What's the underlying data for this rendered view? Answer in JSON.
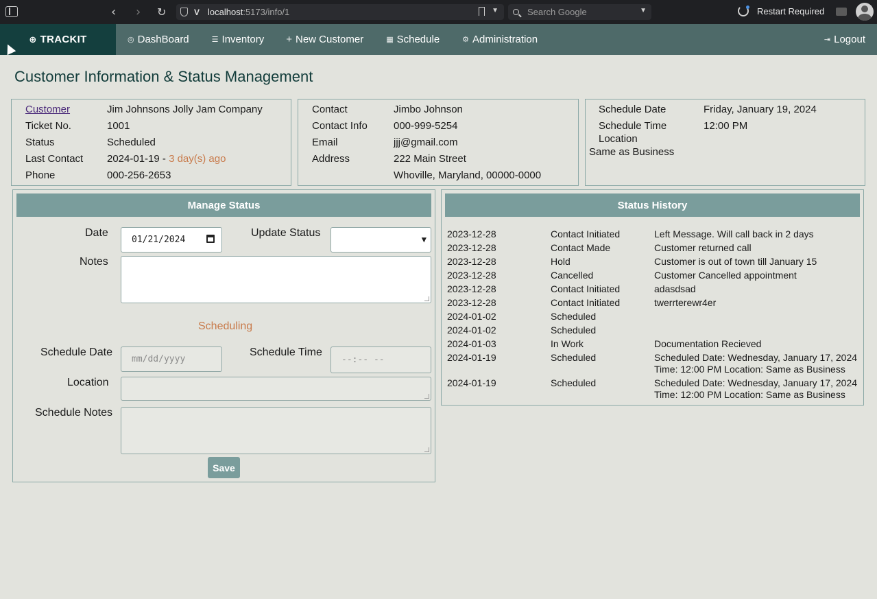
{
  "browser": {
    "url_host": "localhost",
    "url_path": ":5173/info/1",
    "search_placeholder": "Search Google",
    "restart_label": "Restart Required"
  },
  "nav": {
    "brand": "TRACKIT",
    "items": [
      {
        "label": "DashBoard",
        "icon": "dashboard-icon"
      },
      {
        "label": "Inventory",
        "icon": "list-icon"
      },
      {
        "label": "New Customer",
        "icon": "plus-icon"
      },
      {
        "label": "Schedule",
        "icon": "calendar-icon"
      },
      {
        "label": "Administration",
        "icon": "gear-icon"
      }
    ],
    "logout": "Logout"
  },
  "page_title": "Customer Information & Status Management",
  "customer": {
    "customer_label": "Customer",
    "customer_value": "Jim Johnsons Jolly Jam Company",
    "ticket_label": "Ticket No.",
    "ticket_value": "1001",
    "status_label": "Status",
    "status_value": "Scheduled",
    "last_contact_label": "Last Contact",
    "last_contact_value": "2024-01-19 -",
    "last_contact_ago": "3 day(s) ago",
    "phone_label": "Phone",
    "phone_value": "000-256-2653"
  },
  "contact": {
    "contact_label": "Contact",
    "contact_value": "Jimbo Johnson",
    "info_label": "Contact Info",
    "info_value": "000-999-5254",
    "email_label": "Email",
    "email_value": "jjj@gmail.com",
    "address_label": "Address",
    "address_line1": "222 Main Street",
    "address_line2": "Whoville, Maryland, 00000-0000"
  },
  "schedule": {
    "date_label": "Schedule Date",
    "date_value": "Friday, January 19, 2024",
    "time_label": "Schedule Time",
    "time_value": "12:00 PM",
    "location_label": "Location",
    "location_value": "Same as Business"
  },
  "manage": {
    "title": "Manage Status",
    "date_label": "Date",
    "date_value": "01/21/2024",
    "update_status_label": "Update Status",
    "update_status_value": "",
    "notes_label": "Notes",
    "scheduling_heading": "Scheduling",
    "schedule_date_label": "Schedule Date",
    "schedule_date_placeholder": "mm/dd/yyyy",
    "schedule_time_label": "Schedule Time",
    "schedule_time_placeholder": "--:-- --",
    "location_label": "Location",
    "schedule_notes_label": "Schedule Notes",
    "save_label": "Save"
  },
  "history": {
    "title": "Status History",
    "rows": [
      {
        "date": "2023-12-28",
        "status": "Contact Initiated",
        "note": "Left Message. Will call back in 2 days"
      },
      {
        "date": "2023-12-28",
        "status": "Contact Made",
        "note": "Customer returned call"
      },
      {
        "date": "2023-12-28",
        "status": "Hold",
        "note": "Customer is out of town till January 15"
      },
      {
        "date": "2023-12-28",
        "status": "Cancelled",
        "note": "Customer Cancelled appointment"
      },
      {
        "date": "2023-12-28",
        "status": "Contact Initiated",
        "note": "adasdsad"
      },
      {
        "date": "2023-12-28",
        "status": "Contact Initiated",
        "note": "twerrterewr4er"
      },
      {
        "date": "2024-01-02",
        "status": "Scheduled",
        "note": ""
      },
      {
        "date": "2024-01-02",
        "status": "Scheduled",
        "note": ""
      },
      {
        "date": "2024-01-03",
        "status": "In Work",
        "note": "Documentation Recieved"
      },
      {
        "date": "2024-01-19",
        "status": "Scheduled",
        "note": "Scheduled Date: Wednesday, January 17, 2024 Time: 12:00 PM Location: Same as Business"
      },
      {
        "date": "2024-01-19",
        "status": "Scheduled",
        "note": "Scheduled Date: Wednesday, January 17, 2024 Time: 12:00 PM Location: Same as Business"
      }
    ]
  }
}
